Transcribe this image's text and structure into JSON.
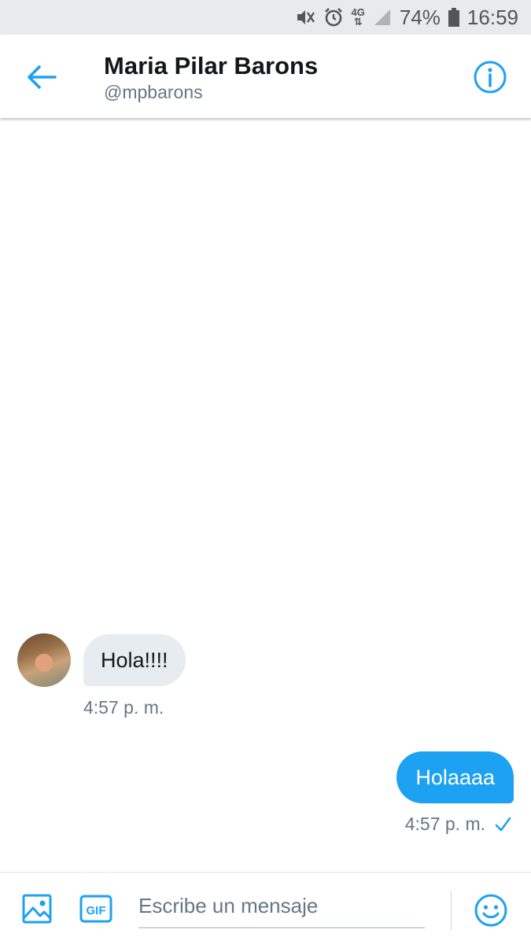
{
  "status_bar": {
    "battery": "74%",
    "time": "16:59",
    "network": "4G"
  },
  "header": {
    "name": "Maria Pilar Barons",
    "handle": "@mpbarons"
  },
  "messages": [
    {
      "direction": "incoming",
      "text": "Hola!!!!",
      "time": "4:57 p. m."
    },
    {
      "direction": "outgoing",
      "text": "Holaaaa",
      "time": "4:57 p. m.",
      "status": "sent"
    }
  ],
  "composer": {
    "placeholder": "Escribe un mensaje",
    "gif_label": "GIF"
  },
  "colors": {
    "accent": "#1da1f2",
    "incoming_bubble": "#e6ecf0",
    "secondary_text": "#657786"
  }
}
